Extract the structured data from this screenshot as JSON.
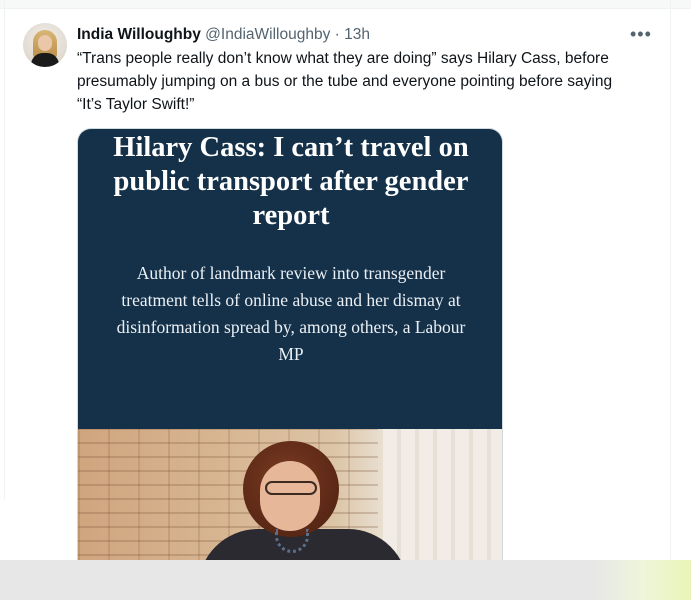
{
  "tweet": {
    "display_name": "India Willoughby",
    "handle": "@IndiaWilloughby",
    "separator": "·",
    "time": "13h",
    "more_icon": "more-horizontal-icon",
    "text": "“Trans people really don’t know what they are doing” says Hilary Cass, before presumably jumping on a bus or the tube and everyone pointing before saying “It’s Taylor Swift!”",
    "media": {
      "headline": "Hilary Cass: I can’t travel on public transport after gender report",
      "standfirst": "Author of landmark review into transgender treatment tells of online abuse and her dismay at disinformation spread by, among others, a Labour MP"
    }
  },
  "colors": {
    "card_background": "#153149",
    "text_primary": "#0f1419",
    "text_secondary": "#536471"
  }
}
